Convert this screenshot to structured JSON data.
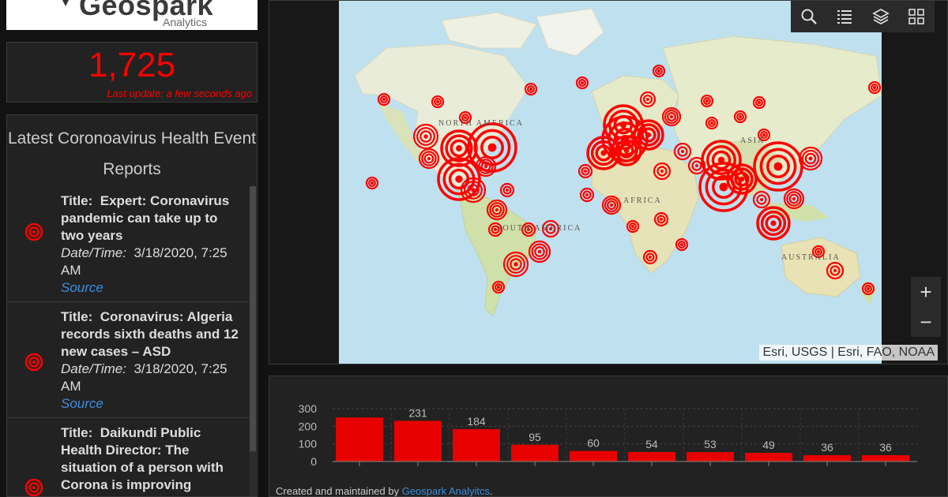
{
  "logo": {
    "name": "Geospark",
    "tagline": "Analytics"
  },
  "counter": {
    "value": "1,725",
    "last_update": "Last update: a few seconds ago"
  },
  "reports": {
    "title": "Latest Coronoavirus Health Event Reports",
    "items": [
      {
        "title_label": "Title:",
        "title": "Expert: Coronavirus pandemic can take up to two years",
        "date_label": "Date/Time:",
        "date": "3/18/2020, 7:25 AM",
        "source": "Source"
      },
      {
        "title_label": "Title:",
        "title": "Coronavirus: Algeria records sixth deaths and 12 new cases – ASD",
        "date_label": "Date/Time:",
        "date": "3/18/2020, 7:25 AM",
        "source": "Source"
      },
      {
        "title_label": "Title:",
        "title": "Daikundi Public Health Director: The situation of a person with Corona is improving",
        "date_label": "",
        "date": "",
        "source": ""
      }
    ],
    "scroll_fraction": 0.15
  },
  "map": {
    "labels": {
      "north_america": "NORTH AMERICA",
      "south_america": "SOUTH AMERICA",
      "africa": "AFRICA",
      "asia": "ASIA",
      "australia": "AUSTRALIA"
    },
    "attribution": "Esri, USGS | Esri, FAO, NOAA",
    "toolbar": [
      "search-icon",
      "list-icon",
      "layers-icon",
      "basemap-gallery-icon"
    ],
    "zoom_in": "+",
    "zoom_out": "−",
    "accent": "#ff0000"
  },
  "chart_data": {
    "type": "bar",
    "values": [
      250,
      231,
      184,
      95,
      60,
      54,
      53,
      49,
      36,
      36
    ],
    "data_labels": [
      "",
      "231",
      "184",
      "95",
      "60",
      "54",
      "53",
      "49",
      "36",
      "36"
    ],
    "y_ticks": [
      0,
      100,
      200,
      300
    ],
    "ylim": [
      0,
      300
    ],
    "grid": true,
    "bar_color": "#e60000"
  },
  "footer": {
    "text": "Created and maintained by ",
    "link": "Geospark Analyitcs",
    "suffix": "."
  }
}
